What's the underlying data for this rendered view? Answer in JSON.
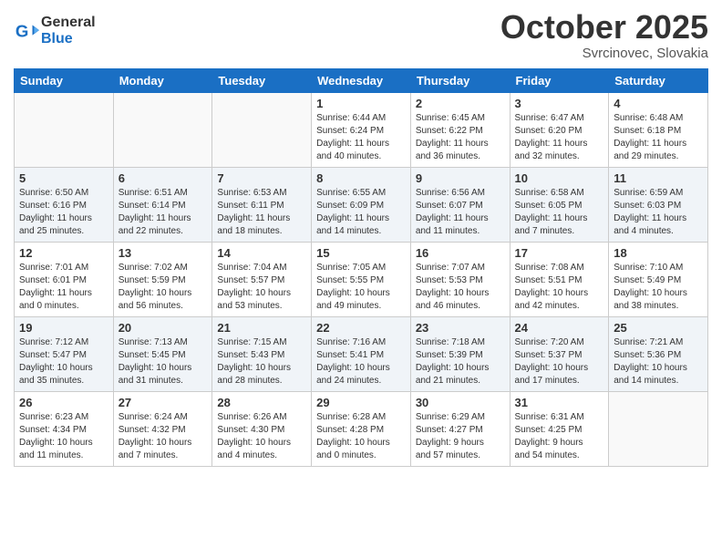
{
  "header": {
    "logo_line1": "General",
    "logo_line2": "Blue",
    "month": "October 2025",
    "location": "Svrcinovec, Slovakia"
  },
  "weekdays": [
    "Sunday",
    "Monday",
    "Tuesday",
    "Wednesday",
    "Thursday",
    "Friday",
    "Saturday"
  ],
  "weeks": [
    [
      {
        "day": "",
        "info": ""
      },
      {
        "day": "",
        "info": ""
      },
      {
        "day": "",
        "info": ""
      },
      {
        "day": "1",
        "info": "Sunrise: 6:44 AM\nSunset: 6:24 PM\nDaylight: 11 hours\nand 40 minutes."
      },
      {
        "day": "2",
        "info": "Sunrise: 6:45 AM\nSunset: 6:22 PM\nDaylight: 11 hours\nand 36 minutes."
      },
      {
        "day": "3",
        "info": "Sunrise: 6:47 AM\nSunset: 6:20 PM\nDaylight: 11 hours\nand 32 minutes."
      },
      {
        "day": "4",
        "info": "Sunrise: 6:48 AM\nSunset: 6:18 PM\nDaylight: 11 hours\nand 29 minutes."
      }
    ],
    [
      {
        "day": "5",
        "info": "Sunrise: 6:50 AM\nSunset: 6:16 PM\nDaylight: 11 hours\nand 25 minutes."
      },
      {
        "day": "6",
        "info": "Sunrise: 6:51 AM\nSunset: 6:14 PM\nDaylight: 11 hours\nand 22 minutes."
      },
      {
        "day": "7",
        "info": "Sunrise: 6:53 AM\nSunset: 6:11 PM\nDaylight: 11 hours\nand 18 minutes."
      },
      {
        "day": "8",
        "info": "Sunrise: 6:55 AM\nSunset: 6:09 PM\nDaylight: 11 hours\nand 14 minutes."
      },
      {
        "day": "9",
        "info": "Sunrise: 6:56 AM\nSunset: 6:07 PM\nDaylight: 11 hours\nand 11 minutes."
      },
      {
        "day": "10",
        "info": "Sunrise: 6:58 AM\nSunset: 6:05 PM\nDaylight: 11 hours\nand 7 minutes."
      },
      {
        "day": "11",
        "info": "Sunrise: 6:59 AM\nSunset: 6:03 PM\nDaylight: 11 hours\nand 4 minutes."
      }
    ],
    [
      {
        "day": "12",
        "info": "Sunrise: 7:01 AM\nSunset: 6:01 PM\nDaylight: 11 hours\nand 0 minutes."
      },
      {
        "day": "13",
        "info": "Sunrise: 7:02 AM\nSunset: 5:59 PM\nDaylight: 10 hours\nand 56 minutes."
      },
      {
        "day": "14",
        "info": "Sunrise: 7:04 AM\nSunset: 5:57 PM\nDaylight: 10 hours\nand 53 minutes."
      },
      {
        "day": "15",
        "info": "Sunrise: 7:05 AM\nSunset: 5:55 PM\nDaylight: 10 hours\nand 49 minutes."
      },
      {
        "day": "16",
        "info": "Sunrise: 7:07 AM\nSunset: 5:53 PM\nDaylight: 10 hours\nand 46 minutes."
      },
      {
        "day": "17",
        "info": "Sunrise: 7:08 AM\nSunset: 5:51 PM\nDaylight: 10 hours\nand 42 minutes."
      },
      {
        "day": "18",
        "info": "Sunrise: 7:10 AM\nSunset: 5:49 PM\nDaylight: 10 hours\nand 38 minutes."
      }
    ],
    [
      {
        "day": "19",
        "info": "Sunrise: 7:12 AM\nSunset: 5:47 PM\nDaylight: 10 hours\nand 35 minutes."
      },
      {
        "day": "20",
        "info": "Sunrise: 7:13 AM\nSunset: 5:45 PM\nDaylight: 10 hours\nand 31 minutes."
      },
      {
        "day": "21",
        "info": "Sunrise: 7:15 AM\nSunset: 5:43 PM\nDaylight: 10 hours\nand 28 minutes."
      },
      {
        "day": "22",
        "info": "Sunrise: 7:16 AM\nSunset: 5:41 PM\nDaylight: 10 hours\nand 24 minutes."
      },
      {
        "day": "23",
        "info": "Sunrise: 7:18 AM\nSunset: 5:39 PM\nDaylight: 10 hours\nand 21 minutes."
      },
      {
        "day": "24",
        "info": "Sunrise: 7:20 AM\nSunset: 5:37 PM\nDaylight: 10 hours\nand 17 minutes."
      },
      {
        "day": "25",
        "info": "Sunrise: 7:21 AM\nSunset: 5:36 PM\nDaylight: 10 hours\nand 14 minutes."
      }
    ],
    [
      {
        "day": "26",
        "info": "Sunrise: 6:23 AM\nSunset: 4:34 PM\nDaylight: 10 hours\nand 11 minutes."
      },
      {
        "day": "27",
        "info": "Sunrise: 6:24 AM\nSunset: 4:32 PM\nDaylight: 10 hours\nand 7 minutes."
      },
      {
        "day": "28",
        "info": "Sunrise: 6:26 AM\nSunset: 4:30 PM\nDaylight: 10 hours\nand 4 minutes."
      },
      {
        "day": "29",
        "info": "Sunrise: 6:28 AM\nSunset: 4:28 PM\nDaylight: 10 hours\nand 0 minutes."
      },
      {
        "day": "30",
        "info": "Sunrise: 6:29 AM\nSunset: 4:27 PM\nDaylight: 9 hours\nand 57 minutes."
      },
      {
        "day": "31",
        "info": "Sunrise: 6:31 AM\nSunset: 4:25 PM\nDaylight: 9 hours\nand 54 minutes."
      },
      {
        "day": "",
        "info": ""
      }
    ]
  ]
}
